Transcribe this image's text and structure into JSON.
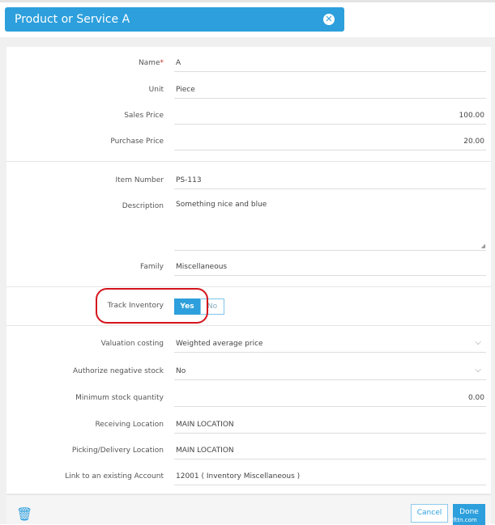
{
  "header": {
    "title": "Product or Service A",
    "close_icon": "close-circle-icon"
  },
  "fields": {
    "name": {
      "label": "Name",
      "required": "*",
      "value": "A"
    },
    "unit": {
      "label": "Unit",
      "value": "Piece"
    },
    "sales_price": {
      "label": "Sales Price",
      "value": "100.00"
    },
    "purchase_price": {
      "label": "Purchase Price",
      "value": "20.00"
    },
    "item_number": {
      "label": "Item Number",
      "value": "PS-113"
    },
    "description": {
      "label": "Description",
      "value": "Something nice and blue"
    },
    "family": {
      "label": "Family",
      "value": "Miscellaneous"
    },
    "track_inventory": {
      "label": "Track Inventory",
      "yes": "Yes",
      "no": "No",
      "selected": "Yes"
    },
    "valuation_costing": {
      "label": "Valuation costing",
      "value": "Weighted average price"
    },
    "authorize_negative": {
      "label": "Authorize negative stock",
      "value": "No"
    },
    "minimum_stock": {
      "label": "Minimum stock quantity",
      "value": "0.00"
    },
    "receiving_location": {
      "label": "Receiving Location",
      "value": "MAIN LOCATION"
    },
    "picking_location": {
      "label": "Picking/Delivery Location",
      "value": "MAIN LOCATION"
    },
    "account": {
      "label": "Link to an existing Account",
      "value": "12001  ( Inventory Miscellaneous )"
    }
  },
  "footer": {
    "cancel": "Cancel",
    "done": "Done",
    "watermark": "efttn.com"
  },
  "colors": {
    "accent": "#2d9fdc",
    "annotation": "#d3141c"
  }
}
